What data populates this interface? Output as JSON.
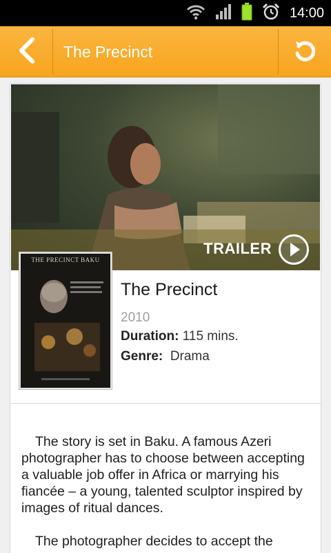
{
  "status_bar": {
    "time": "14:00",
    "icons": [
      "wifi-icon",
      "signal-icon",
      "battery-icon",
      "alarm-icon"
    ]
  },
  "action_bar": {
    "title": "The Precinct",
    "back_icon": "chevron-left-icon",
    "refresh_icon": "refresh-icon",
    "color": "#f9ab2a"
  },
  "hero": {
    "trailer_label": "TRAILER",
    "play_icon": "play-icon"
  },
  "poster": {
    "title_text": "THE PRECINCT BAKU"
  },
  "movie": {
    "title": "The Precinct",
    "year": "2010",
    "duration_label": "Duration:",
    "duration_value": "115 mins.",
    "genre_label": "Genre:",
    "genre_value": "Drama"
  },
  "synopsis": {
    "paragraphs": [
      "The story is set in Baku. A famous Azeri photographer has to choose between accepting a valuable job offer in Africa or marrying his fiancée – a young, talented sculptor inspired by images of ritual dances.",
      "The photographer decides to accept the"
    ]
  }
}
